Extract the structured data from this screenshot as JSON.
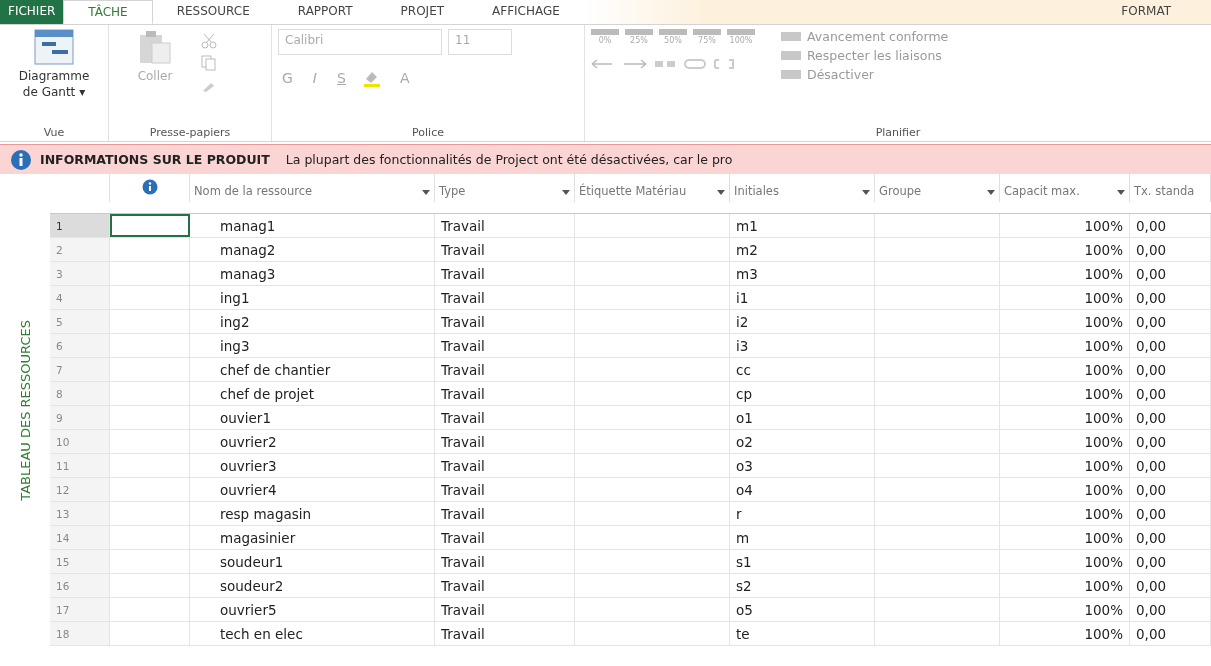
{
  "tabs": [
    {
      "label": "FICHIER",
      "kind": "file",
      "selected": false
    },
    {
      "label": "TÂCHE",
      "kind": "tab",
      "selected": true
    },
    {
      "label": "RESSOURCE",
      "kind": "tab",
      "selected": false
    },
    {
      "label": "RAPPORT",
      "kind": "tab",
      "selected": false
    },
    {
      "label": "PROJET",
      "kind": "tab",
      "selected": false
    },
    {
      "label": "AFFICHAGE",
      "kind": "tab",
      "selected": false
    },
    {
      "label": "FORMAT",
      "kind": "context",
      "selected": false
    }
  ],
  "ribbon": {
    "view": {
      "button": "Diagramme de Gantt ▾",
      "group": "Vue"
    },
    "clipboard": {
      "button": "Coller",
      "disabled": true,
      "group": "Presse-papiers"
    },
    "font": {
      "family": "Calibri",
      "size": "11",
      "bold": "G",
      "italic": "I",
      "underline": "S",
      "text_color": "A",
      "group": "Police"
    },
    "schedule": {
      "percents": [
        "0%",
        "25%",
        "50%",
        "75%",
        "100%"
      ],
      "commands": [
        {
          "label": "Avancement conforme",
          "disabled": true
        },
        {
          "label": "Respecter les liaisons",
          "disabled": true
        },
        {
          "label": "Désactiver",
          "disabled": true
        }
      ],
      "group": "Planifier"
    }
  },
  "info_bar": {
    "title": "INFORMATIONS SUR LE PRODUIT",
    "message": "La plupart des fonctionnalités de Project ont été désactivées, car le pro"
  },
  "side_label": "TABLEAU DES RESSOURCES",
  "table": {
    "columns": [
      {
        "label": "Nom de la ressource",
        "filter": true
      },
      {
        "label": "Type",
        "filter": true
      },
      {
        "label": "Étiquette Matériau",
        "filter": true
      },
      {
        "label": "Initiales",
        "filter": true
      },
      {
        "label": "Groupe",
        "filter": true
      },
      {
        "label": "Capacit max.",
        "filter": true
      },
      {
        "label": "Tx. standa",
        "filter": false
      }
    ],
    "rows": [
      {
        "num": "1",
        "name": "manag1",
        "type": "Travail",
        "initials": "m1",
        "capacity": "100%",
        "rate": "0,00",
        "selected": true
      },
      {
        "num": "2",
        "name": "manag2",
        "type": "Travail",
        "initials": "m2",
        "capacity": "100%",
        "rate": "0,00",
        "selected": false
      },
      {
        "num": "3",
        "name": "manag3",
        "type": "Travail",
        "initials": "m3",
        "capacity": "100%",
        "rate": "0,00",
        "selected": false
      },
      {
        "num": "4",
        "name": "ing1",
        "type": "Travail",
        "initials": "i1",
        "capacity": "100%",
        "rate": "0,00",
        "selected": false
      },
      {
        "num": "5",
        "name": "ing2",
        "type": "Travail",
        "initials": "i2",
        "capacity": "100%",
        "rate": "0,00",
        "selected": false
      },
      {
        "num": "6",
        "name": "ing3",
        "type": "Travail",
        "initials": "i3",
        "capacity": "100%",
        "rate": "0,00",
        "selected": false
      },
      {
        "num": "7",
        "name": "chef de chantier",
        "type": "Travail",
        "initials": "cc",
        "capacity": "100%",
        "rate": "0,00",
        "selected": false
      },
      {
        "num": "8",
        "name": "chef de projet",
        "type": "Travail",
        "initials": "cp",
        "capacity": "100%",
        "rate": "0,00",
        "selected": false
      },
      {
        "num": "9",
        "name": "ouvier1",
        "type": "Travail",
        "initials": "o1",
        "capacity": "100%",
        "rate": "0,00",
        "selected": false
      },
      {
        "num": "10",
        "name": "ouvrier2",
        "type": "Travail",
        "initials": "o2",
        "capacity": "100%",
        "rate": "0,00",
        "selected": false
      },
      {
        "num": "11",
        "name": "ouvrier3",
        "type": "Travail",
        "initials": "o3",
        "capacity": "100%",
        "rate": "0,00",
        "selected": false
      },
      {
        "num": "12",
        "name": "ouvrier4",
        "type": "Travail",
        "initials": "o4",
        "capacity": "100%",
        "rate": "0,00",
        "selected": false
      },
      {
        "num": "13",
        "name": "resp magasin",
        "type": "Travail",
        "initials": "r",
        "capacity": "100%",
        "rate": "0,00",
        "selected": false
      },
      {
        "num": "14",
        "name": "magasinier",
        "type": "Travail",
        "initials": "m",
        "capacity": "100%",
        "rate": "0,00",
        "selected": false
      },
      {
        "num": "15",
        "name": "soudeur1",
        "type": "Travail",
        "initials": "s1",
        "capacity": "100%",
        "rate": "0,00",
        "selected": false
      },
      {
        "num": "16",
        "name": "soudeur2",
        "type": "Travail",
        "initials": "s2",
        "capacity": "100%",
        "rate": "0,00",
        "selected": false
      },
      {
        "num": "17",
        "name": "ouvrier5",
        "type": "Travail",
        "initials": "o5",
        "capacity": "100%",
        "rate": "0,00",
        "selected": false
      },
      {
        "num": "18",
        "name": "tech en elec",
        "type": "Travail",
        "initials": "te",
        "capacity": "100%",
        "rate": "0,00",
        "selected": false
      }
    ]
  }
}
